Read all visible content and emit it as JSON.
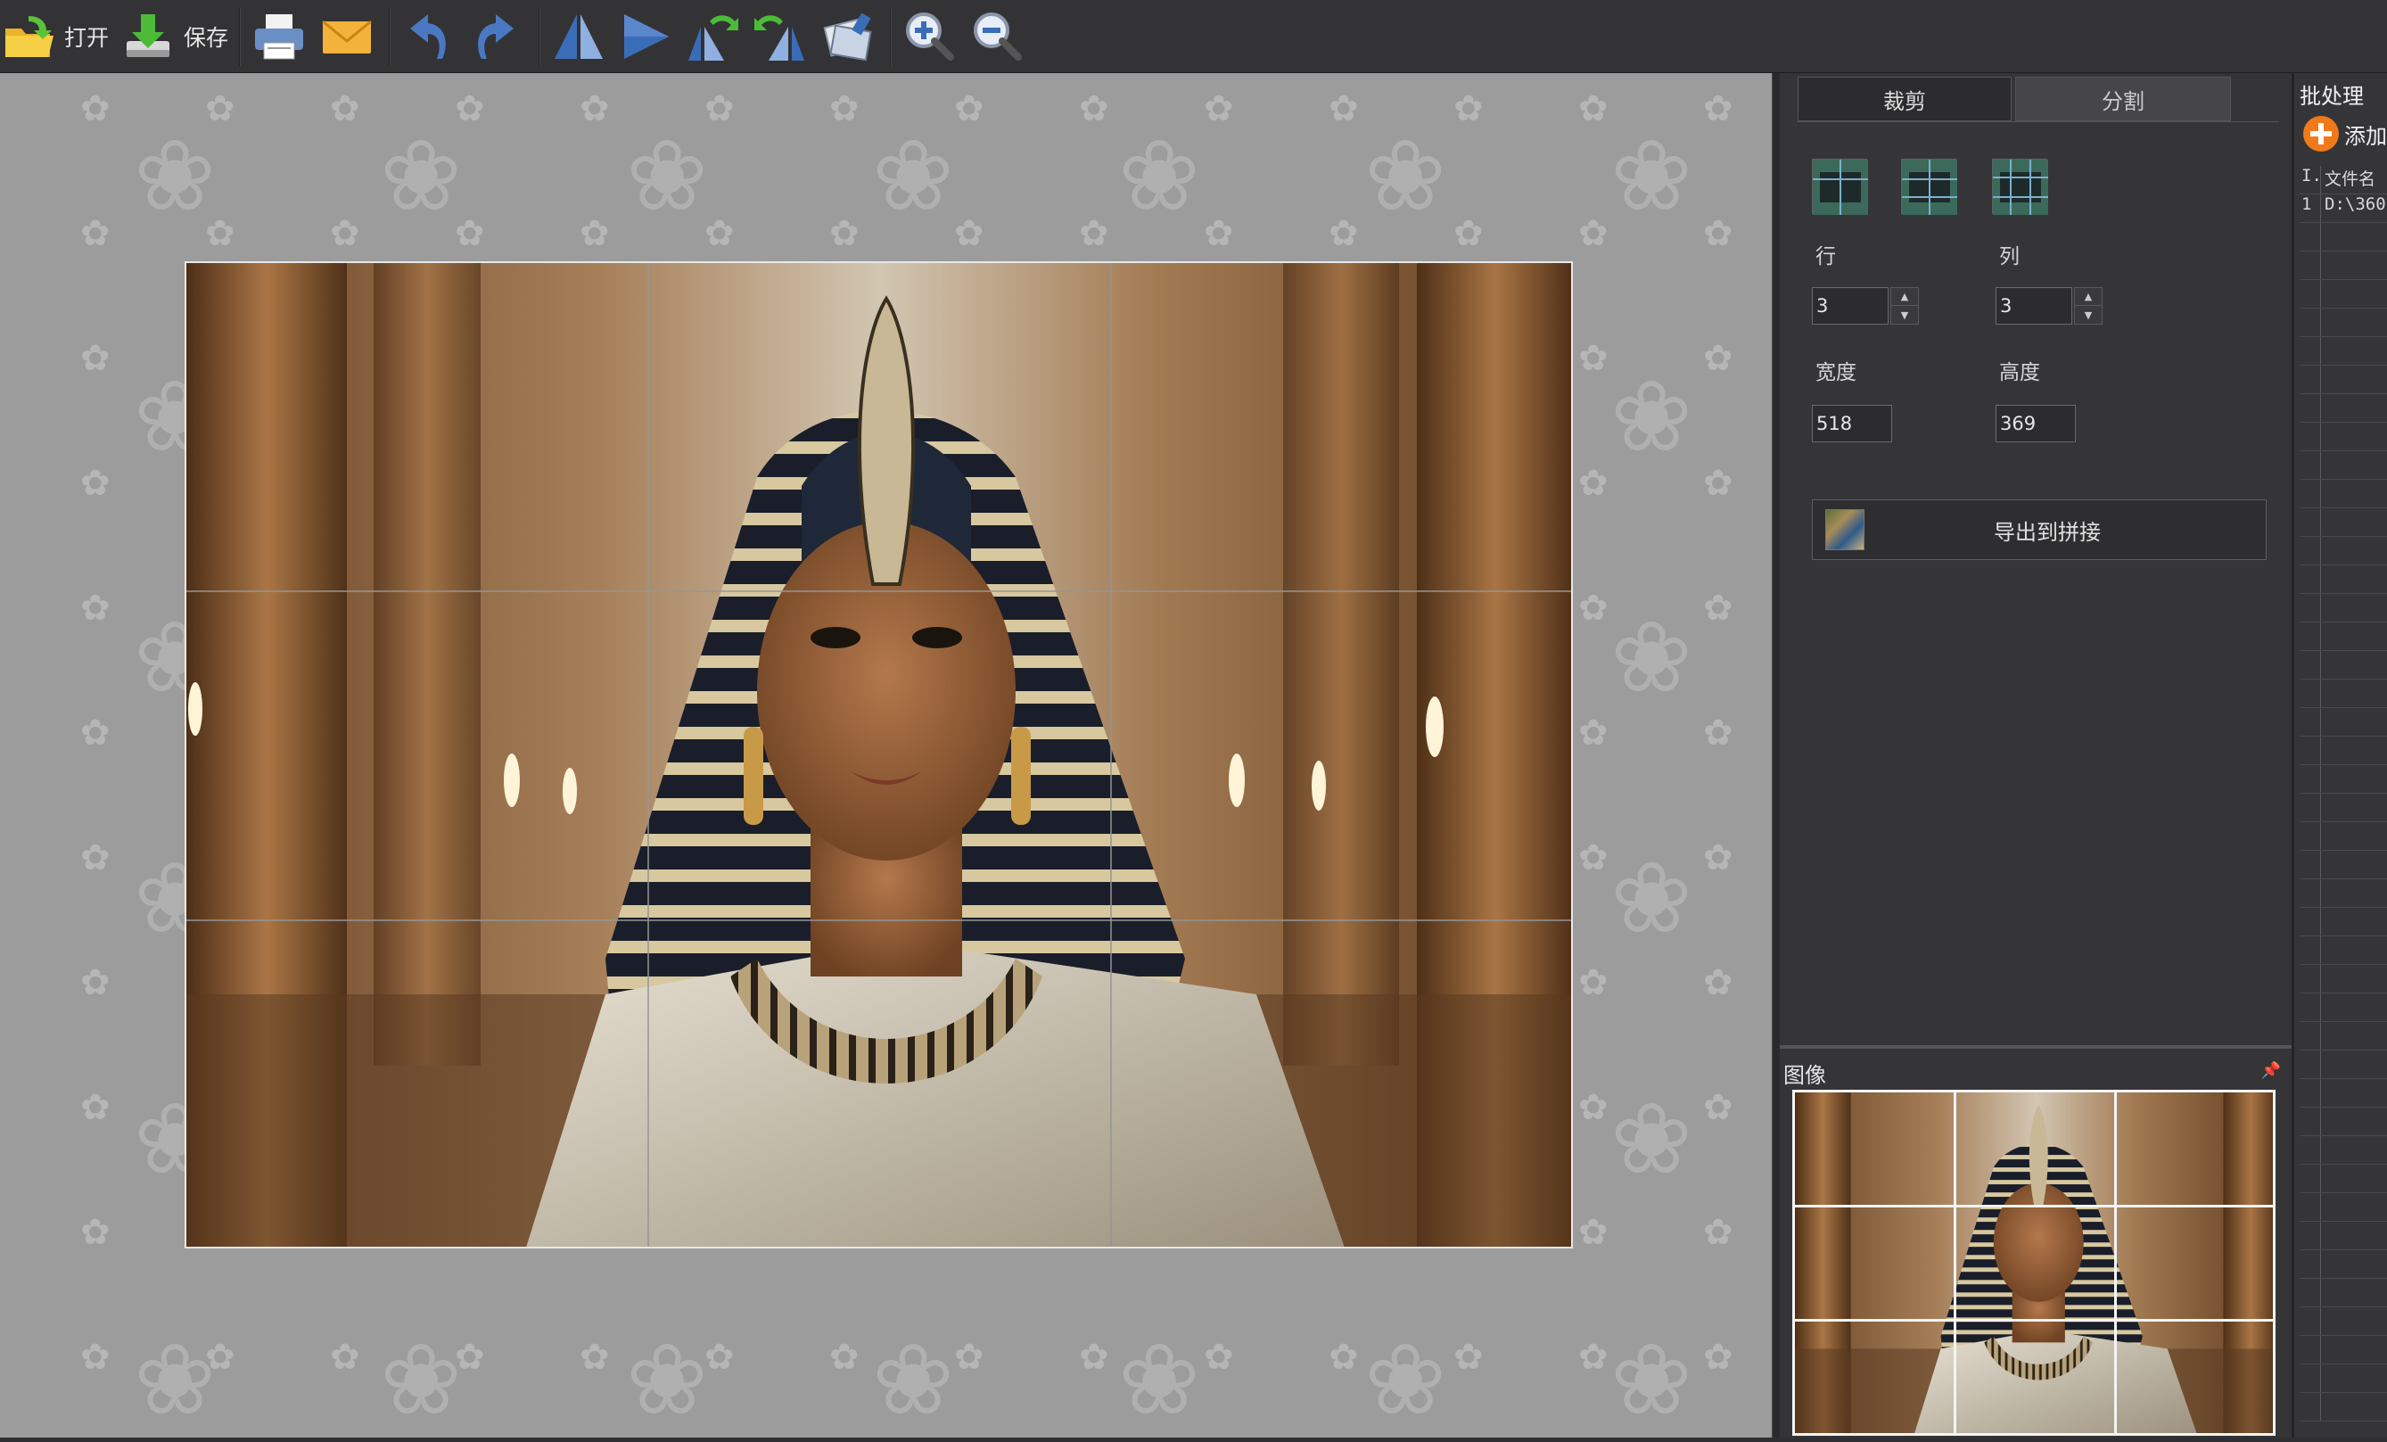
{
  "toolbar": {
    "open_label": "打开",
    "save_label": "保存"
  },
  "tabs": {
    "crop_label": "裁剪",
    "split_label": "分割"
  },
  "split": {
    "rows_label": "行",
    "cols_label": "列",
    "rows_value": "3",
    "cols_value": "3",
    "width_label": "宽度",
    "height_label": "高度",
    "width_value": "518",
    "height_value": "369",
    "export_label": "导出到拼接"
  },
  "preview": {
    "title": "图像"
  },
  "batch": {
    "title": "批处理",
    "add_label": "添加",
    "columns": [
      "I.",
      "文件名"
    ],
    "rows": [
      {
        "index": "1",
        "path": "D:\\360"
      }
    ]
  },
  "colors": {
    "accent_add": "#f07a1a",
    "canvas_bg": "#9c9c9c",
    "panel_bg": "#353538"
  }
}
